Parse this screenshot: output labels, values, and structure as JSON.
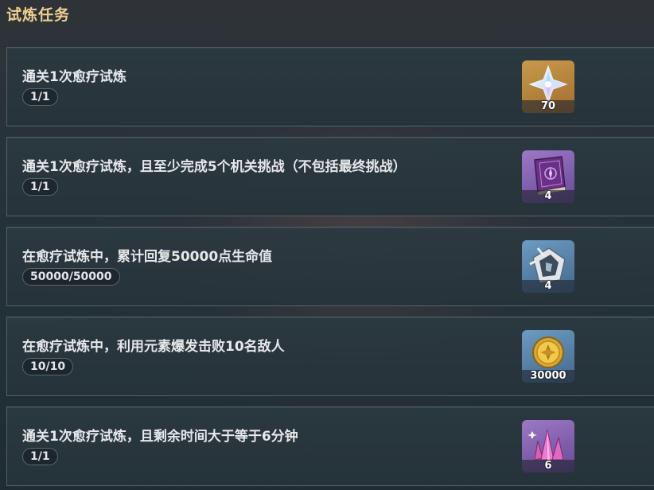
{
  "header": {
    "title": "试炼任务"
  },
  "tasks": [
    {
      "title": "通关1次愈疗试炼",
      "progress": "1/1",
      "reward": {
        "icon": "primogem-icon",
        "count": "70",
        "bg": "#b5823f"
      }
    },
    {
      "title": "通关1次愈疗试炼，且至少完成5个机关挑战（不包括最终挑战）",
      "progress": "1/1",
      "reward": {
        "icon": "heros-wit-book-icon",
        "count": "4",
        "bg": "#7d5eb0"
      }
    },
    {
      "title": "在愈疗试炼中，累计回复50000点生命值",
      "progress": "50000/50000",
      "reward": {
        "icon": "mystic-enhancement-ore-icon",
        "count": "4",
        "bg": "#5a82a8"
      }
    },
    {
      "title": "在愈疗试炼中，利用元素爆发击败10名敌人",
      "progress": "10/10",
      "reward": {
        "icon": "mora-coin-icon",
        "count": "30000",
        "bg": "#5a82a8"
      }
    },
    {
      "title": "通关1次愈疗试炼，且剩余时间大于等于6分钟",
      "progress": "1/1",
      "reward": {
        "icon": "crystal-cluster-icon",
        "count": "6",
        "bg": "#7d5eb0"
      }
    }
  ]
}
